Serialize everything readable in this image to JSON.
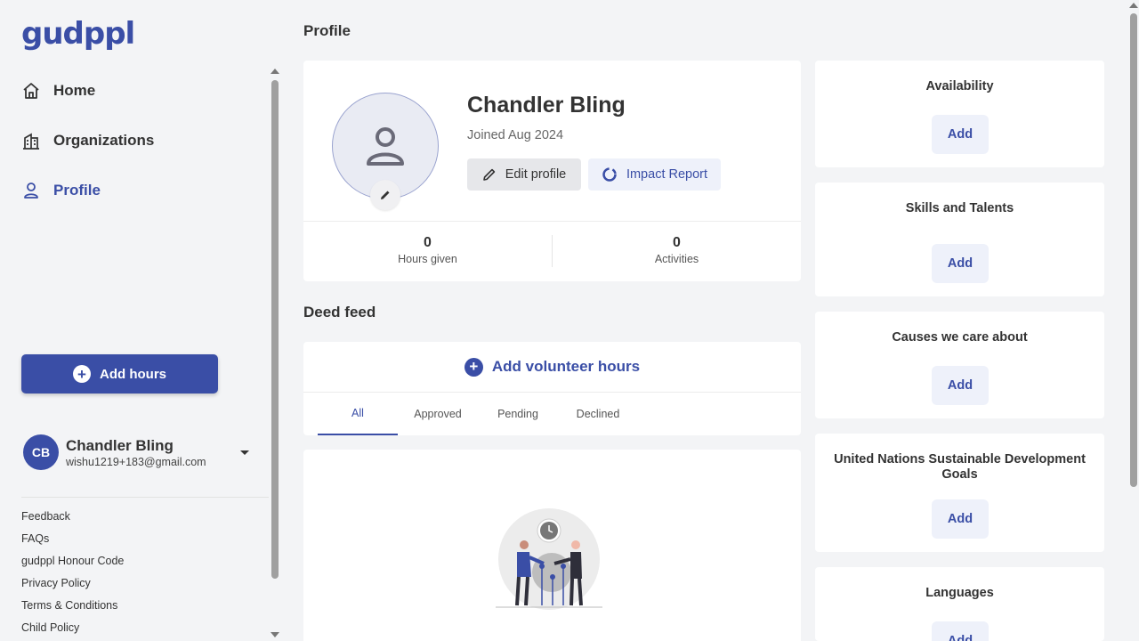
{
  "logo": "gudppl",
  "nav": [
    {
      "label": "Home",
      "icon": "home-icon"
    },
    {
      "label": "Organizations",
      "icon": "building-icon"
    },
    {
      "label": "Profile",
      "icon": "person-icon"
    }
  ],
  "sidebar": {
    "add_hours": "Add hours",
    "user": {
      "initials": "CB",
      "name": "Chandler Bling",
      "email": "wishu1219+183@gmail.com"
    },
    "footer_links": [
      "Feedback",
      "FAQs",
      "gudppl Honour Code",
      "Privacy Policy",
      "Terms & Conditions",
      "Child Policy"
    ]
  },
  "page_title": "Profile",
  "profile": {
    "name": "Chandler Bling",
    "joined": "Joined Aug 2024",
    "edit_label": "Edit profile",
    "impact_label": "Impact Report",
    "stats": [
      {
        "value": "0",
        "label": "Hours given"
      },
      {
        "value": "0",
        "label": "Activities"
      }
    ]
  },
  "deed_feed": {
    "title": "Deed feed",
    "add_label": "Add volunteer hours",
    "tabs": [
      "All",
      "Approved",
      "Pending",
      "Declined"
    ],
    "active_tab": "All"
  },
  "side_cards": [
    {
      "title": "Availability",
      "button": "Add"
    },
    {
      "title": "Skills and Talents",
      "button": "Add"
    },
    {
      "title": "Causes we care about",
      "button": "Add"
    },
    {
      "title": "United Nations Sustainable Development Goals",
      "button": "Add"
    },
    {
      "title": "Languages",
      "button": "Add"
    }
  ],
  "colors": {
    "accent": "#3a4ea6",
    "background": "#f3f4f6",
    "card": "#ffffff",
    "soft_button": "#eef1fa"
  }
}
